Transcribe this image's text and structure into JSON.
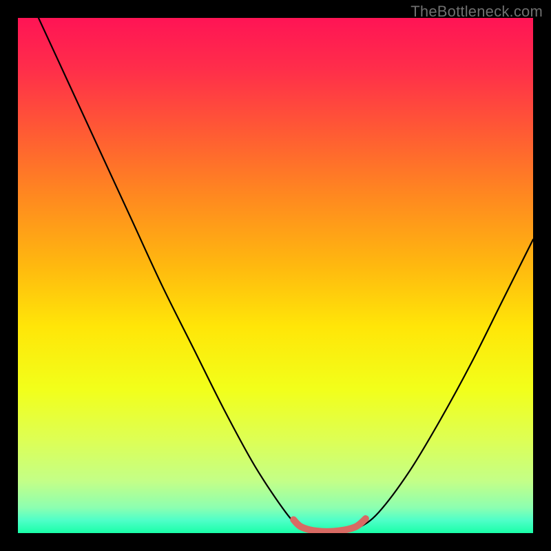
{
  "watermark": "TheBottleneck.com",
  "colors": {
    "frame": "#000000",
    "curve": "#000000",
    "accent": "#d86a63",
    "gradient_stops": [
      {
        "offset": 0.0,
        "color": "#ff1455"
      },
      {
        "offset": 0.1,
        "color": "#ff2e4a"
      },
      {
        "offset": 0.22,
        "color": "#ff5a34"
      },
      {
        "offset": 0.35,
        "color": "#ff8a1f"
      },
      {
        "offset": 0.48,
        "color": "#ffb80f"
      },
      {
        "offset": 0.6,
        "color": "#ffe608"
      },
      {
        "offset": 0.72,
        "color": "#f2ff1a"
      },
      {
        "offset": 0.82,
        "color": "#ddff55"
      },
      {
        "offset": 0.9,
        "color": "#c3ff88"
      },
      {
        "offset": 0.95,
        "color": "#8dffb0"
      },
      {
        "offset": 0.975,
        "color": "#4fffc8"
      },
      {
        "offset": 1.0,
        "color": "#19ffa8"
      }
    ]
  },
  "chart_data": {
    "type": "line",
    "title": "",
    "xlabel": "",
    "ylabel": "",
    "xlim": [
      0,
      1
    ],
    "ylim": [
      0,
      1
    ],
    "series": [
      {
        "name": "bottleneck-curve",
        "x": [
          0.04,
          0.1,
          0.16,
          0.22,
          0.28,
          0.34,
          0.4,
          0.46,
          0.52,
          0.55,
          0.58,
          0.62,
          0.66,
          0.7,
          0.76,
          0.82,
          0.88,
          0.94,
          1.0
        ],
        "y": [
          1.0,
          0.87,
          0.74,
          0.61,
          0.48,
          0.36,
          0.24,
          0.13,
          0.04,
          0.01,
          0.0,
          0.0,
          0.01,
          0.04,
          0.12,
          0.22,
          0.33,
          0.45,
          0.57
        ]
      }
    ],
    "accent_segment": {
      "name": "optimal-zone",
      "x": [
        0.535,
        0.55,
        0.58,
        0.62,
        0.655,
        0.675
      ],
      "y": [
        0.026,
        0.012,
        0.004,
        0.004,
        0.012,
        0.028
      ]
    }
  }
}
